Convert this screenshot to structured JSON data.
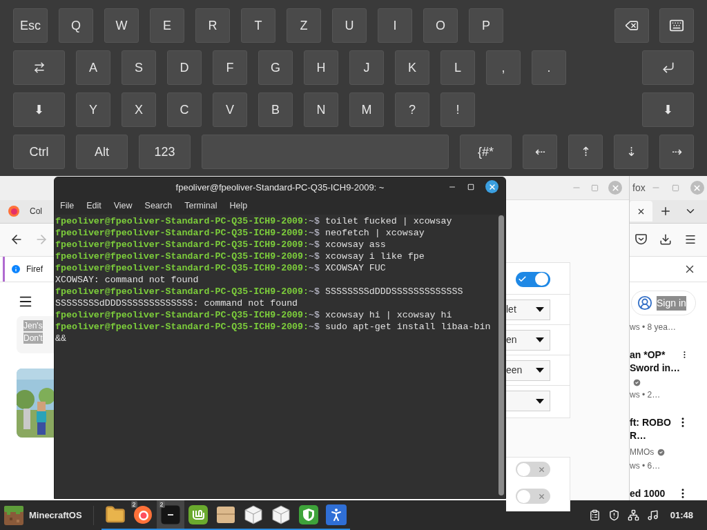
{
  "keyboard": {
    "rows": [
      {
        "left": [
          {
            "label": "Esc",
            "kind": "letter"
          },
          {
            "label": "Q",
            "kind": "letter"
          },
          {
            "label": "W",
            "kind": "letter"
          },
          {
            "label": "E",
            "kind": "letter"
          },
          {
            "label": "R",
            "kind": "letter"
          },
          {
            "label": "T",
            "kind": "letter"
          },
          {
            "label": "Z",
            "kind": "letter"
          },
          {
            "label": "U",
            "kind": "letter"
          },
          {
            "label": "I",
            "kind": "letter"
          },
          {
            "label": "O",
            "kind": "letter"
          },
          {
            "label": "P",
            "kind": "letter"
          }
        ],
        "right": [
          {
            "kind": "backspace"
          },
          {
            "kind": "keyboard"
          }
        ]
      },
      {
        "left": [
          {
            "kind": "tab"
          },
          {
            "label": "A",
            "kind": "letter"
          },
          {
            "label": "S",
            "kind": "letter"
          },
          {
            "label": "D",
            "kind": "letter"
          },
          {
            "label": "F",
            "kind": "letter"
          },
          {
            "label": "G",
            "kind": "letter"
          },
          {
            "label": "H",
            "kind": "letter"
          },
          {
            "label": "J",
            "kind": "letter"
          },
          {
            "label": "K",
            "kind": "letter"
          },
          {
            "label": "L",
            "kind": "letter"
          },
          {
            "label": ",",
            "kind": "letter"
          },
          {
            "label": ".",
            "kind": "letter"
          }
        ],
        "right": [
          {
            "kind": "enter"
          }
        ]
      },
      {
        "left": [
          {
            "label": "⬇",
            "kind": "wide"
          },
          {
            "label": "Y",
            "kind": "letter"
          },
          {
            "label": "X",
            "kind": "letter"
          },
          {
            "label": "C",
            "kind": "letter"
          },
          {
            "label": "V",
            "kind": "letter"
          },
          {
            "label": "B",
            "kind": "letter"
          },
          {
            "label": "N",
            "kind": "letter"
          },
          {
            "label": "M",
            "kind": "letter"
          },
          {
            "label": "?",
            "kind": "letter"
          },
          {
            "label": "!",
            "kind": "letter"
          }
        ],
        "right": [
          {
            "label": "⬇",
            "kind": "wide"
          }
        ]
      },
      {
        "left": [
          {
            "label": "Ctrl",
            "kind": "wide"
          },
          {
            "label": "Alt",
            "kind": "wide"
          },
          {
            "label": "123",
            "kind": "wide"
          },
          {
            "kind": "space"
          },
          {
            "label": "{#*",
            "kind": "wide"
          },
          {
            "label": "⇠",
            "kind": "letter"
          },
          {
            "label": "⇡",
            "kind": "letter"
          },
          {
            "label": "⇣",
            "kind": "letter"
          },
          {
            "label": "⇢",
            "kind": "letter"
          }
        ]
      }
    ]
  },
  "firefox": {
    "title": "fox",
    "tab": "Col",
    "notice": "Firef",
    "card_lines": [
      "Jen's",
      "Don't"
    ],
    "sign_in": "Sign in",
    "top_meta": "ws • 8 yea…",
    "videos": [
      {
        "title_lines": [
          "an *OP*",
          "Sword in…"
        ],
        "verified": true,
        "meta": "ws • 2…"
      },
      {
        "title_lines": [
          "ft: ROBO",
          "R…"
        ],
        "channel": "MMOs",
        "verified": true,
        "meta": "ws • 6…"
      },
      {
        "title_lines": [
          "ed 1000"
        ]
      }
    ]
  },
  "settings": {
    "card1": [
      {
        "kind": "toggle",
        "on": true
      },
      {
        "kind": "dropdown",
        "value": "let"
      },
      {
        "kind": "dropdown",
        "value": "en"
      },
      {
        "kind": "dropdown",
        "value": "een"
      },
      {
        "kind": "dropdown"
      }
    ],
    "card2": [
      {
        "kind": "toggle",
        "on": false
      },
      {
        "kind": "toggle",
        "on": false
      }
    ]
  },
  "terminal": {
    "title": "fpeoliver@fpeoliver-Standard-PC-Q35-ICH9-2009: ~",
    "menu": [
      "File",
      "Edit",
      "View",
      "Search",
      "Terminal",
      "Help"
    ],
    "lines": [
      {
        "kind": "prompt",
        "prompt": "fpeoliver@fpeoliver-Standard-PC-Q35-ICH9-2009:",
        "path": "~$",
        "command": " toilet fucked | xcowsay"
      },
      {
        "kind": "prompt",
        "prompt": "fpeoliver@fpeoliver-Standard-PC-Q35-ICH9-2009:",
        "path": "~$",
        "command": " neofetch | xcowsay"
      },
      {
        "kind": "prompt",
        "prompt": "fpeoliver@fpeoliver-Standard-PC-Q35-ICH9-2009:",
        "path": "~$",
        "command": " xcowsay ass"
      },
      {
        "kind": "prompt",
        "prompt": "fpeoliver@fpeoliver-Standard-PC-Q35-ICH9-2009:",
        "path": "~$",
        "command": " xcowsay i like fpe"
      },
      {
        "kind": "prompt",
        "prompt": "fpeoliver@fpeoliver-Standard-PC-Q35-ICH9-2009:",
        "path": "~$",
        "command": " XCOWSAY FUC"
      },
      {
        "kind": "output",
        "text": "XCOWSAY: command not found"
      },
      {
        "kind": "prompt",
        "prompt": "fpeoliver@fpeoliver-Standard-PC-Q35-ICH9-2009:",
        "path": "~$",
        "command": " SSSSSSSSdDDDSSSSSSSSSSSSS"
      },
      {
        "kind": "output",
        "text": "SSSSSSSSdDDDSSSSSSSSSSSSS: command not found"
      },
      {
        "kind": "prompt",
        "prompt": "fpeoliver@fpeoliver-Standard-PC-Q35-ICH9-2009:",
        "path": "~$",
        "command": " xcowsay hi | xcowsay hi"
      },
      {
        "kind": "prompt",
        "prompt": "fpeoliver@fpeoliver-Standard-PC-Q35-ICH9-2009:",
        "path": "~$",
        "command": " sudo apt-get install libaa-bin"
      },
      {
        "kind": "output",
        "text": "&&"
      }
    ]
  },
  "taskbar": {
    "menu_label": "MinecraftOS",
    "apps": [
      {
        "kind": "folder",
        "selected": false
      },
      {
        "kind": "firefox",
        "badge": "2",
        "selected": false
      },
      {
        "kind": "terminal",
        "badge": "2",
        "selected": true
      },
      {
        "kind": "mint",
        "selected": false
      },
      {
        "kind": "box",
        "selected": false
      },
      {
        "kind": "cube",
        "selected": false
      },
      {
        "kind": "cube",
        "selected": false
      },
      {
        "kind": "shield",
        "selected": false
      },
      {
        "kind": "accessibility",
        "selected": false
      }
    ],
    "clock": "01:48"
  }
}
